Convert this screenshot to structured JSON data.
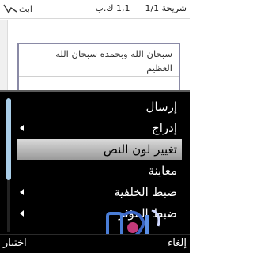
{
  "status_bar": {
    "input_mode": "ابث",
    "size": "1,1 ك.ب",
    "message_position": "شريحة 1/1"
  },
  "note": {
    "lines": [
      "سبحان الله وبحمده سبحان الله",
      "العظيم"
    ]
  },
  "menu": {
    "items": [
      {
        "label": "إرسال",
        "has_submenu": false,
        "selected": false
      },
      {
        "label": "إدراج",
        "has_submenu": true,
        "selected": false
      },
      {
        "label": "تغيير لون النص",
        "has_submenu": false,
        "selected": true
      },
      {
        "label": "معاينة",
        "has_submenu": false,
        "selected": false
      },
      {
        "label": "ضبط الخلفية",
        "has_submenu": true,
        "selected": false
      },
      {
        "label": "ضبط المؤثر",
        "has_submenu": true,
        "selected": false
      }
    ]
  },
  "softkeys": {
    "left": "اختيار",
    "right": "إلغاء"
  },
  "colors": {
    "menu_background": "#000000",
    "menu_text": "#ffffff",
    "selection_top": "#d9d9d9",
    "selection_bottom": "#9a9a9a",
    "scroll_thumb": "#a9cde8",
    "note_border": "#8a8aa6"
  }
}
